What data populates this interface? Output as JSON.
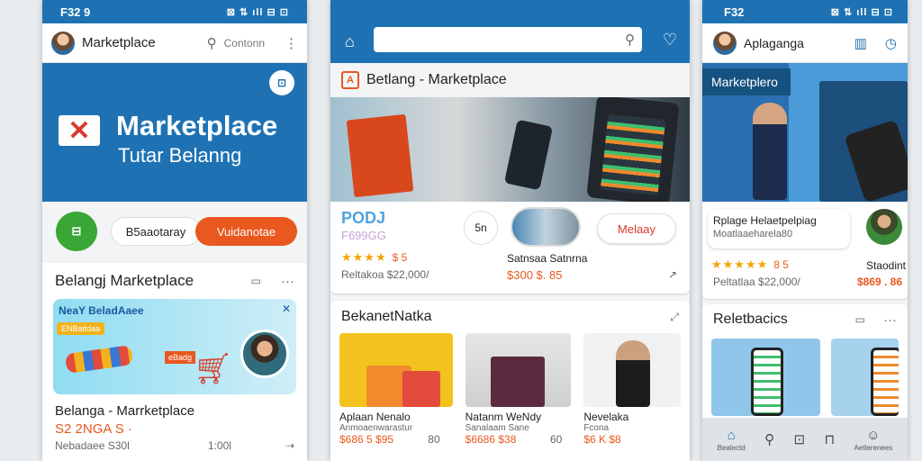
{
  "phone1": {
    "status": {
      "time": "F32 9",
      "icons": "⊠ ⇅ ıll ⊟ ⊡"
    },
    "appbar": {
      "title": "Marketplace",
      "search": "Contonn"
    },
    "hero": {
      "title": "Marketplace",
      "subtitle": "Tutar Belanng"
    },
    "pills": {
      "left": "B5aaotaray",
      "right": "Vuidanotae"
    },
    "section": {
      "title": "Belangj Marketplace"
    },
    "banner": {
      "title": "NeaY BeladAaee",
      "tag": "ENBaitdaa",
      "mid": "eBadg"
    },
    "product": {
      "title": "Belanga - Marrketplace",
      "price": "S2 2NGA S ·",
      "meta_left": "Nebadaee S30l",
      "meta_right": "1:00l"
    }
  },
  "phone2": {
    "header": {
      "title": "Betlang - Marketplace"
    },
    "info": {
      "promo": "PODJ",
      "promo_sub": "F699GG",
      "rating": "$ 5",
      "reviews": "Reltakoa $22,000/",
      "round_label": "5n",
      "price": "$300 $. 85",
      "price_label": "Satnsaa Satnrna",
      "button": "Melaay"
    },
    "section": {
      "title": "BekanetNatka"
    },
    "products": [
      {
        "name": "Aplaan Nenalo",
        "sub": "Anmoaenwarastur",
        "price": "$686 5 $95",
        "count": "80"
      },
      {
        "name": "Natanm WeNdy",
        "sub": "Sanalaam Sane",
        "price": "$6686 $38",
        "count": "60"
      },
      {
        "name": "Nevelaka",
        "sub": "Fcona",
        "price": "$6 K $8",
        "count": ""
      }
    ]
  },
  "phone3": {
    "status": {
      "time": "F32",
      "icons": "⊠ ⇅ ıll ⊟ ⊡"
    },
    "appbar": {
      "title": "Aplaganga"
    },
    "banner": {
      "title": "Marketplero"
    },
    "product": {
      "title": "Rplage Helaetpelpiag",
      "sub": "Moatlaaeharela80",
      "rating": "8 5",
      "reviews": "Peltatlaa $22,000/",
      "side_title": "Staodint",
      "side_price": "$869 . 86"
    },
    "section": {
      "title": "Reletbacics"
    },
    "nav": [
      "Bealectd",
      "",
      "",
      "",
      "Aetlerenees"
    ]
  },
  "colors": {
    "brand": "#1e72b3",
    "accent": "#e8581f",
    "green": "#3aa636",
    "star": "#f4a400"
  }
}
